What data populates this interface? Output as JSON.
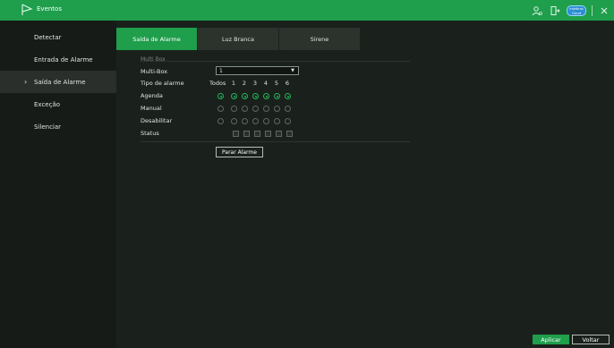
{
  "window": {
    "title": "Eventos",
    "cloud_badge": "Intelbras Cloud"
  },
  "sidebar": {
    "items": [
      {
        "label": "Detectar",
        "active": false
      },
      {
        "label": "Entrada de Alarme",
        "active": false
      },
      {
        "label": "Saída de Alarme",
        "active": true
      },
      {
        "label": "Exceção",
        "active": false
      },
      {
        "label": "Silenciar",
        "active": false
      }
    ]
  },
  "tabs": [
    {
      "label": "Saída de Alarme",
      "active": true
    },
    {
      "label": "Luz Branca",
      "active": false
    },
    {
      "label": "Sirene",
      "active": false
    }
  ],
  "form": {
    "section_title": "Multi Box",
    "multibox_label": "Multi-Box",
    "multibox_value": "1",
    "alarm_type_label": "Tipo de alarme",
    "todos_label": "Todos",
    "channels": [
      "1",
      "2",
      "3",
      "4",
      "5",
      "6"
    ],
    "agenda_label": "Agenda",
    "manual_label": "Manual",
    "disable_label": "Desabilitar",
    "status_label": "Status",
    "selected_mode": "Agenda",
    "stop_alarm_label": "Parar Alarme"
  },
  "footer": {
    "apply_label": "Aplicar",
    "back_label": "Voltar"
  },
  "colors": {
    "accent": "#1f9e4c",
    "radio_on": "#25b35a"
  }
}
